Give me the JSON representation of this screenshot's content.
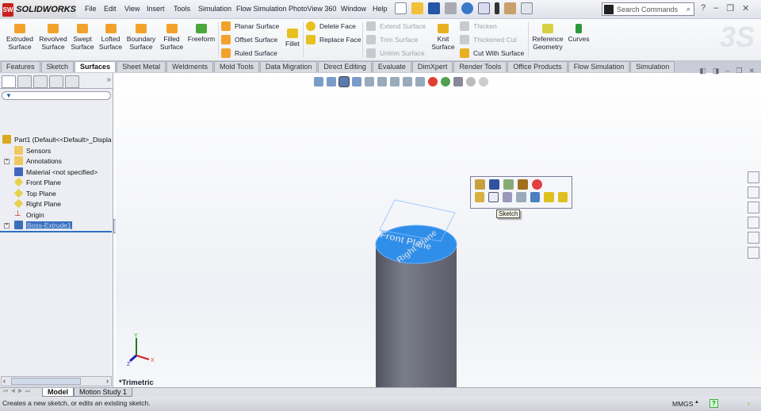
{
  "app": {
    "logo": "SOLIDWORKS",
    "logo_mark": "SW"
  },
  "menu": [
    "File",
    "Edit",
    "View",
    "Insert",
    "Tools",
    "Simulation",
    "Flow Simulation",
    "PhotoView 360",
    "Window",
    "Help"
  ],
  "search": {
    "placeholder": "Search Commands"
  },
  "ribbon": {
    "big": [
      {
        "label": "Extruded Surface"
      },
      {
        "label": "Revolved Surface"
      },
      {
        "label": "Swept Surface"
      },
      {
        "label": "Lofted Surface"
      },
      {
        "label": "Boundary Surface"
      },
      {
        "label": "Filled Surface"
      },
      {
        "label": "Freeform"
      }
    ],
    "col1": [
      "Planar Surface",
      "Offset Surface",
      "Ruled Surface"
    ],
    "fillet": "Fillet",
    "col2": [
      "Delete Face",
      "Replace Face"
    ],
    "col3": [
      "Extend Surface",
      "Trim Surface",
      "Untrim Surface"
    ],
    "knit": "Knit Surface",
    "col4": [
      "Thicken",
      "Thickened Cut",
      "Cut With Surface"
    ],
    "ref": "Reference Geometry",
    "curves": "Curves"
  },
  "tabs": [
    "Features",
    "Sketch",
    "Surfaces",
    "Sheet Metal",
    "Weldments",
    "Mold Tools",
    "Data Migration",
    "Direct Editing",
    "Evaluate",
    "DimXpert",
    "Render Tools",
    "Office Products",
    "Flow Simulation",
    "Simulation"
  ],
  "active_tab": "Surfaces",
  "tree": {
    "root": "Part1  (Default<<Default>_Displa",
    "items": [
      "Sensors",
      "Annotations",
      "Material <not specified>",
      "Front Plane",
      "Top Plane",
      "Right Plane",
      "Origin",
      "Boss-Extrude1"
    ]
  },
  "viewport": {
    "view_label": "*Trimetric",
    "plane_labels": [
      "Front Plane",
      "Right Plane"
    ],
    "tooltip": "Sketch",
    "axes": {
      "x": "X",
      "y": "Y",
      "z": "Z"
    }
  },
  "bottom_tabs": [
    "Model",
    "Motion Study 1"
  ],
  "status": {
    "message": "Creates a new sketch, or edits an existing sketch.",
    "units": "MMGS",
    "help": "?"
  }
}
